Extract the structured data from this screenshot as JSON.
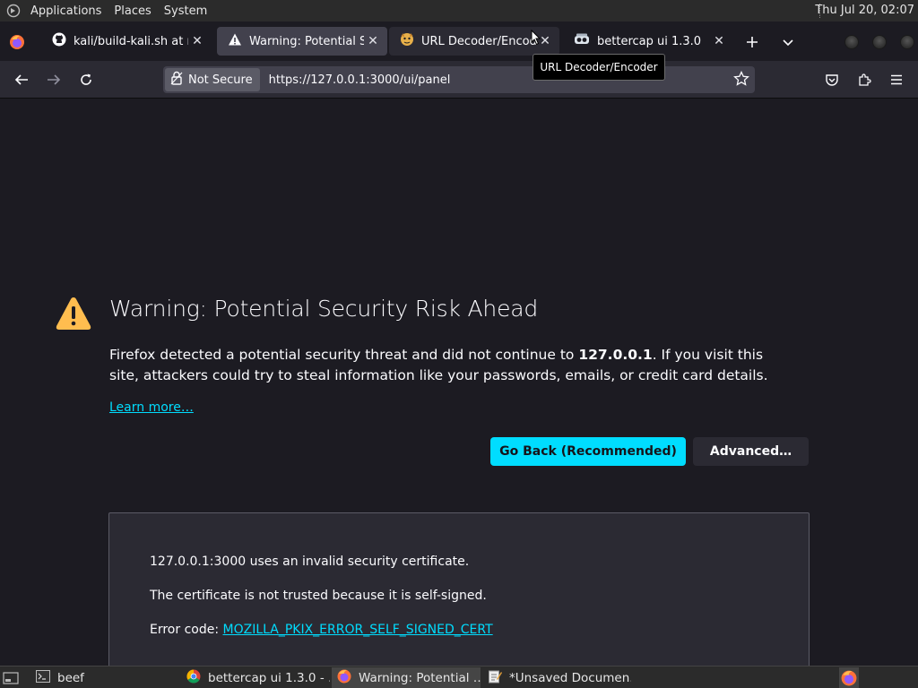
{
  "top_panel": {
    "menus": [
      "Applications",
      "Places",
      "System"
    ],
    "clock": "Thu Jul 20, 02:07"
  },
  "tabs": [
    {
      "label": "kali/build-kali.sh at ma",
      "icon": "github-icon",
      "state": "normal"
    },
    {
      "label": "Warning: Potential Sec",
      "icon": "warning-icon",
      "state": "active"
    },
    {
      "label": "URL Decoder/Encoder",
      "icon": "url-decoder-favicon-icon",
      "state": "hover"
    },
    {
      "label": "bettercap ui 1.3.0",
      "icon": "bettercap-favicon-icon",
      "state": "normal"
    }
  ],
  "tooltip": "URL Decoder/Encoder",
  "navbar": {
    "not_secure_label": "Not Secure",
    "url": "https://127.0.0.1:3000/ui/panel"
  },
  "page": {
    "title": "Warning: Potential Security Risk Ahead",
    "desc_part1": "Firefox detected a potential security threat and did not continue to ",
    "desc_host": "127.0.0.1",
    "desc_part2": ". If you visit this site, attackers could try to steal information like your passwords, emails, or credit card details.",
    "learn_more": "Learn more…",
    "go_back": "Go Back (Recommended)",
    "advanced": "Advanced…",
    "details": {
      "line1": "127.0.0.1:3000 uses an invalid security certificate.",
      "line2": "The certificate is not trusted because it is self-signed.",
      "error_prefix": "Error code: ",
      "error_code": "MOZILLA_PKIX_ERROR_SELF_SIGNED_CERT"
    }
  },
  "taskbar": [
    {
      "label": "beef",
      "icon": "terminal-icon",
      "active": false
    },
    {
      "label": "bettercap ui 1.3.0 - …",
      "icon": "chrome-icon",
      "active": false
    },
    {
      "label": "Warning: Potential …",
      "icon": "firefox-icon",
      "active": true
    },
    {
      "label": "*Unsaved Documen…",
      "icon": "text-editor-icon",
      "active": false
    }
  ],
  "colors": {
    "accent": "#00ddff",
    "warning_yellow": "#ffbd4f",
    "page_bg": "#1c1b22",
    "toolbar_bg": "#2b2a33"
  }
}
